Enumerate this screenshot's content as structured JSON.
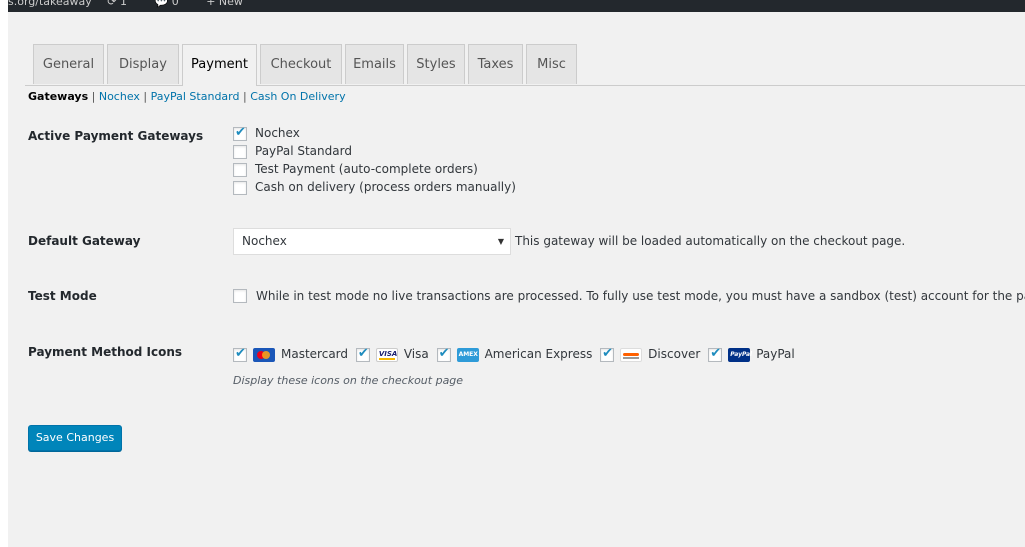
{
  "adminbar": {
    "site": "s.org/takeaway",
    "updates": "1",
    "comments": "0",
    "new": "New"
  },
  "tabs": [
    {
      "label": "General"
    },
    {
      "label": "Display"
    },
    {
      "label": "Payment",
      "active": true
    },
    {
      "label": "Checkout"
    },
    {
      "label": "Emails"
    },
    {
      "label": "Styles"
    },
    {
      "label": "Taxes"
    },
    {
      "label": "Misc"
    }
  ],
  "subnav": {
    "current": "Gateways",
    "sep": " | ",
    "links": [
      "Nochex",
      "PayPal Standard",
      "Cash On Delivery"
    ]
  },
  "gateways": {
    "label": "Active Payment Gateways",
    "options": [
      {
        "label": "Nochex",
        "checked": true
      },
      {
        "label": "PayPal Standard",
        "checked": false
      },
      {
        "label": "Test Payment (auto-complete orders)",
        "checked": false
      },
      {
        "label": "Cash on delivery (process orders manually)",
        "checked": false
      }
    ]
  },
  "default_gateway": {
    "label": "Default Gateway",
    "value": "Nochex",
    "description": "This gateway will be loaded automatically on the checkout page."
  },
  "test_mode": {
    "label": "Test Mode",
    "checked": false,
    "description": "While in test mode no live transactions are processed. To fully use test mode, you must have a sandbox (test) account for the payment"
  },
  "icons": {
    "label": "Payment Method Icons",
    "items": [
      {
        "label": "Mastercard",
        "icon": "mastercard-icon",
        "checked": true
      },
      {
        "label": "Visa",
        "icon": "visa-icon",
        "checked": true
      },
      {
        "label": "American Express",
        "icon": "amex-icon",
        "checked": true
      },
      {
        "label": "Discover",
        "icon": "discover-icon",
        "checked": true
      },
      {
        "label": "PayPal",
        "icon": "paypal-icon",
        "checked": true
      }
    ],
    "description": "Display these icons on the checkout page"
  },
  "save_label": "Save Changes",
  "colors": {
    "accent": "#0085ba",
    "link": "#0073aa",
    "background": "#f1f1f1"
  }
}
